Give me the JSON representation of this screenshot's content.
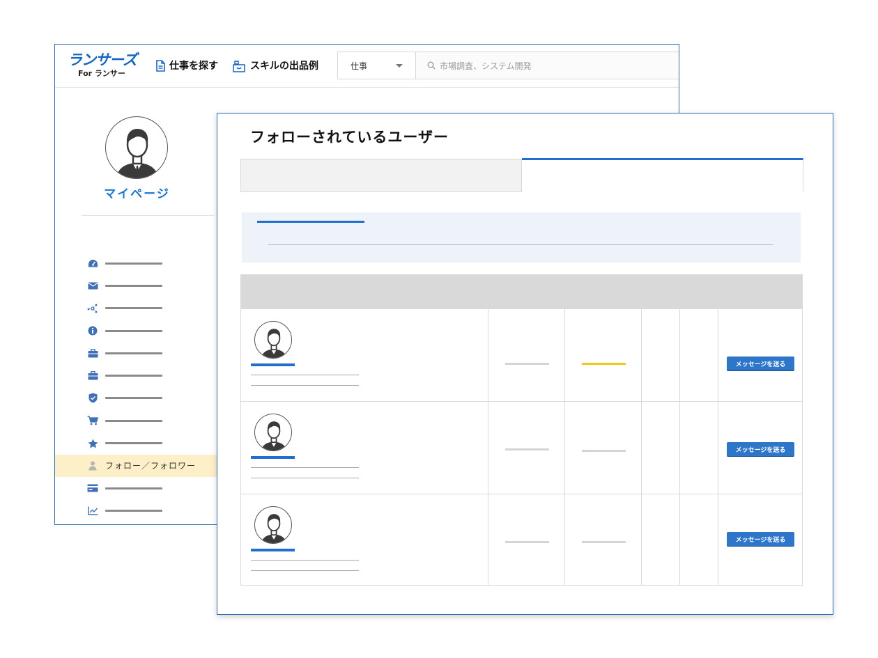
{
  "header": {
    "logo_main": "ランサーズ",
    "logo_sub": "For ランサー",
    "nav_find_jobs": "仕事を探す",
    "nav_skill_examples": "スキルの出品例",
    "search_category": "仕事",
    "search_placeholder": "市場調査、システム開発"
  },
  "sidebar": {
    "title": "マイページ",
    "active_item_label": "フォロー／フォロワー",
    "items": [
      {
        "icon": "dashboard-icon"
      },
      {
        "icon": "mail-icon"
      },
      {
        "icon": "network-icon"
      },
      {
        "icon": "info-icon"
      },
      {
        "icon": "briefcase-icon"
      },
      {
        "icon": "briefcase-icon"
      },
      {
        "icon": "shield-check-icon"
      },
      {
        "icon": "cart-icon"
      },
      {
        "icon": "star-icon"
      },
      {
        "icon": "user-icon",
        "active": true
      },
      {
        "icon": "credit-card-icon"
      },
      {
        "icon": "chart-icon"
      }
    ]
  },
  "panel": {
    "title": "フォローされているユーザー",
    "message_button_label": "メッセージを送る",
    "rows": [
      {
        "status_color": "#f5c518"
      },
      {
        "status_color": "#d4d4d4"
      },
      {
        "status_color": "#d4d4d4"
      }
    ]
  },
  "colors": {
    "brand_blue": "#1565c0",
    "accent_blue": "#1e6fce",
    "active_bg": "#fdefc7",
    "highlight_yellow": "#f5c518"
  }
}
